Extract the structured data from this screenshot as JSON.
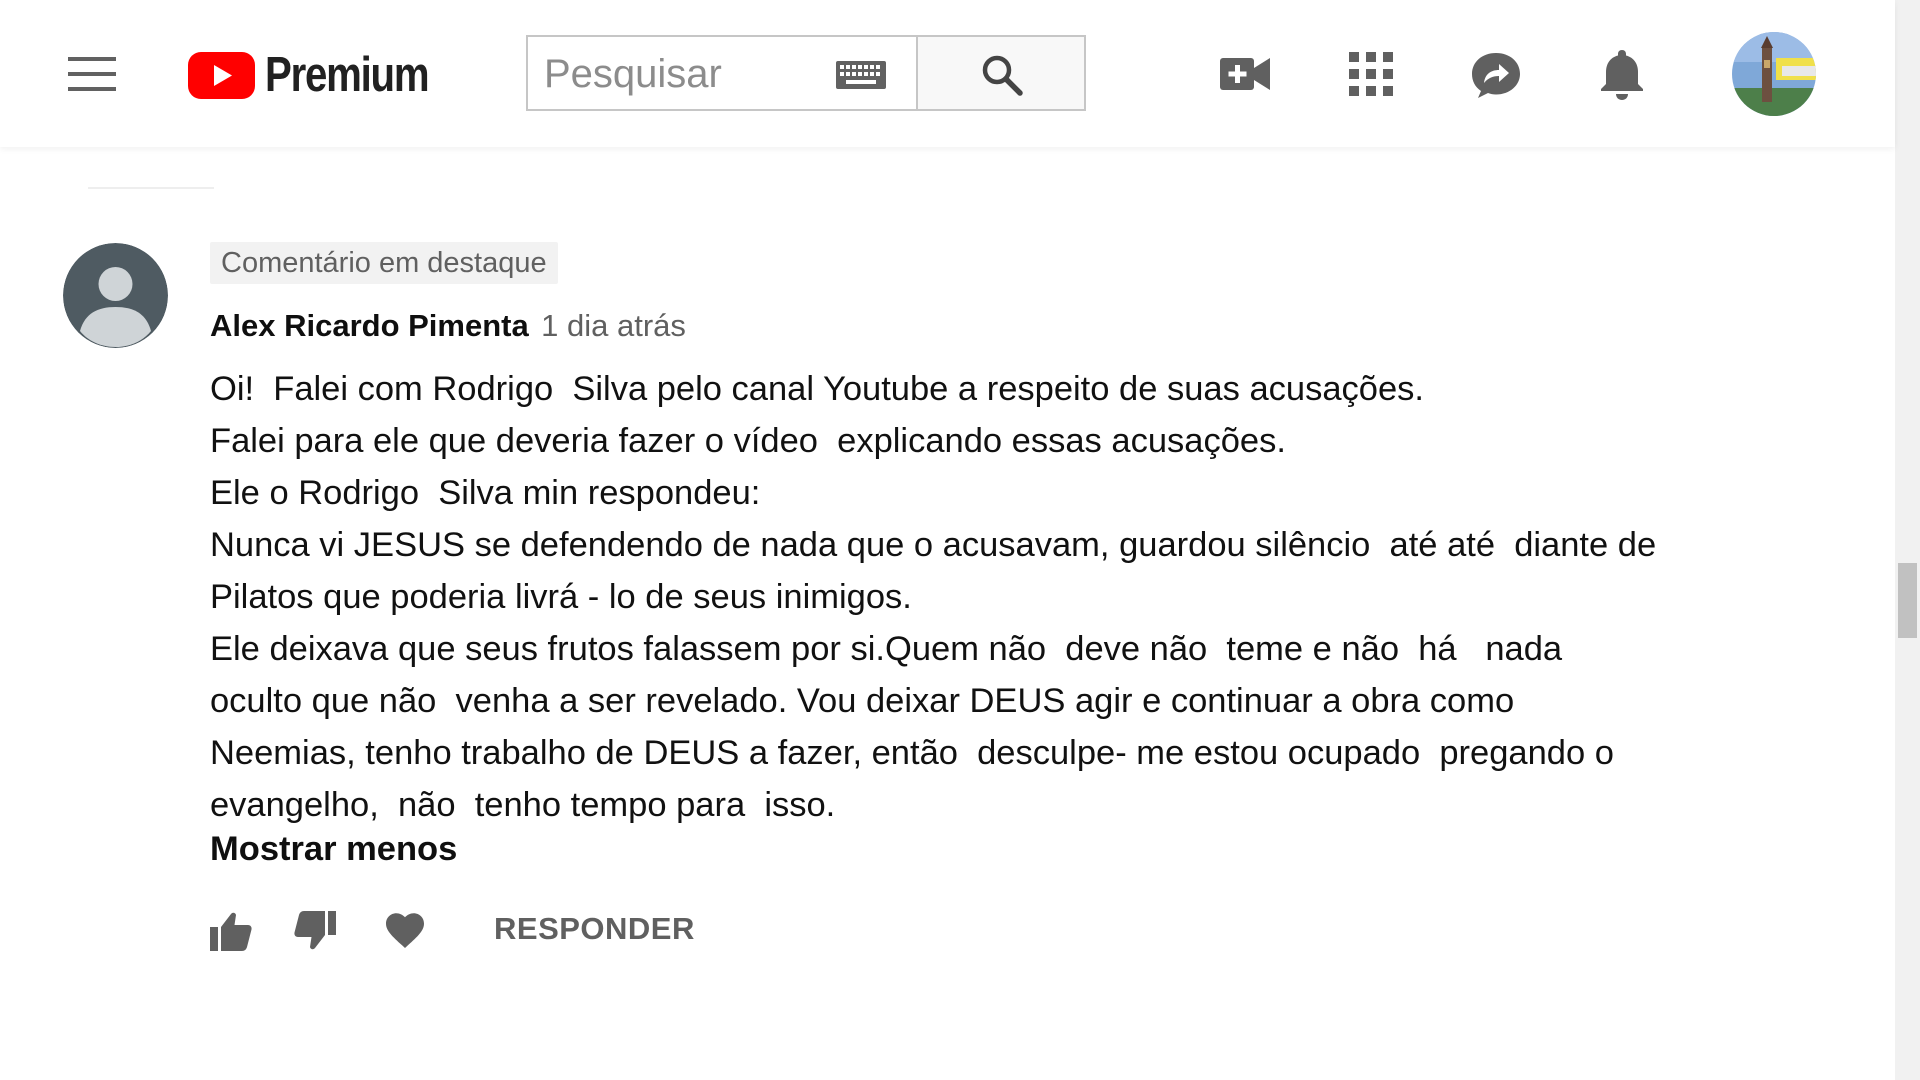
{
  "header": {
    "logo_text": "Premium",
    "search_placeholder": "Pesquisar",
    "icons": [
      "menu-icon",
      "keyboard-icon",
      "search-icon",
      "create-video-icon",
      "apps-icon",
      "share-icon",
      "notifications-icon",
      "account-avatar"
    ]
  },
  "comment": {
    "pinned_label": "Comentário em destaque",
    "author": "Alex Ricardo Pimenta",
    "time": "1 dia atrás",
    "lines": [
      "Oi!  Falei com Rodrigo  Silva pelo canal Youtube a respeito de suas acusações.",
      "Falei para ele que deveria fazer o vídeo  explicando essas acusações.",
      "Ele o Rodrigo  Silva min respondeu:",
      "Nunca vi JESUS se defendendo de nada que o acusavam, guardou silêncio  até até  diante de",
      "Pilatos que poderia livrá - lo de seus inimigos.",
      "Ele deixava que seus frutos falassem por si.Quem não  deve não  teme e não  há   nada",
      "oculto que não  venha a ser revelado. Vou deixar DEUS agir e continuar a obra como",
      "Neemias, tenho trabalho de DEUS a fazer, então  desculpe- me estou ocupado  pregando o",
      "evangelho,  não  tenho tempo para  isso."
    ],
    "show_less": "Mostrar menos",
    "reply": "RESPONDER"
  },
  "colors": {
    "youtube_red": "#ff0000",
    "text_primary": "#111111",
    "text_secondary": "#606060",
    "icon_gray": "#606060"
  }
}
